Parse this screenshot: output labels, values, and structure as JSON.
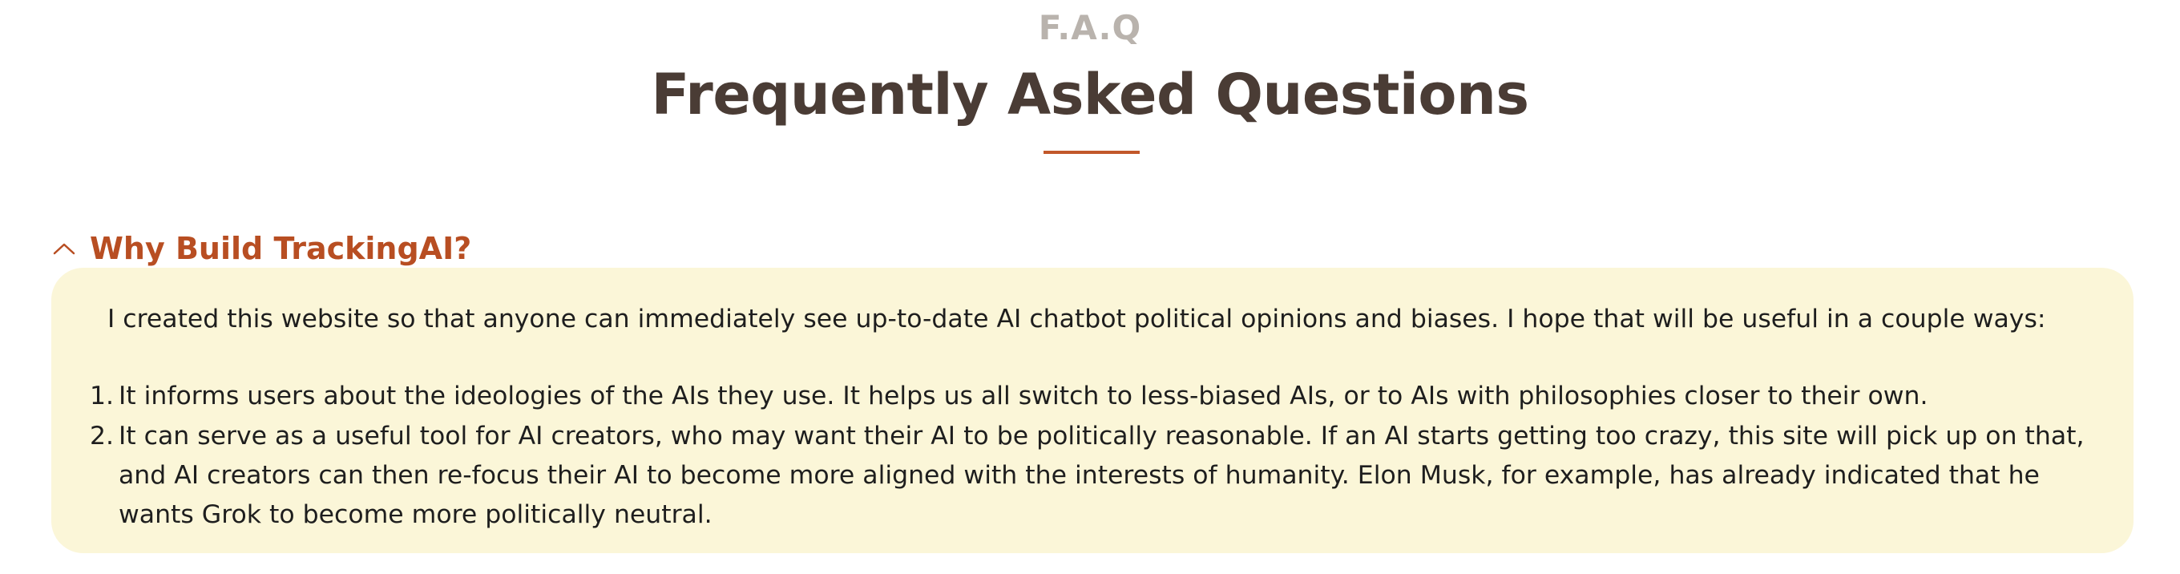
{
  "section": {
    "eyebrow": "F.A.Q",
    "title": "Frequently Asked Questions"
  },
  "faq": {
    "expanded": true,
    "toggle_icon": "chevron-up-icon",
    "question": "Why Build TrackingAI?",
    "intro": "I created this website so that anyone can immediately see up-to-date AI chatbot political opinions and biases. I hope that will be useful in a couple ways:",
    "points": [
      {
        "number": "1.",
        "text": "It informs users about the ideologies of the AIs they use. It helps us all switch to less-biased AIs, or to AIs with philosophies closer to their own."
      },
      {
        "number": "2.",
        "text": "It can serve as a useful tool for AI creators, who may want their AI to be politically reasonable. If an AI starts getting too crazy, this site will pick up on that, and AI creators can then re-focus their AI to become more aligned with the interests of humanity. Elon Musk, for example, has already indicated that he wants Grok to become more politically neutral."
      }
    ]
  },
  "colors": {
    "eyebrow": "#b9b3ad",
    "title": "#4a3c35",
    "accent": "#c2582a",
    "question": "#b84e22",
    "panel_background": "#fbf6d8",
    "body_text": "#1e1e1e"
  }
}
